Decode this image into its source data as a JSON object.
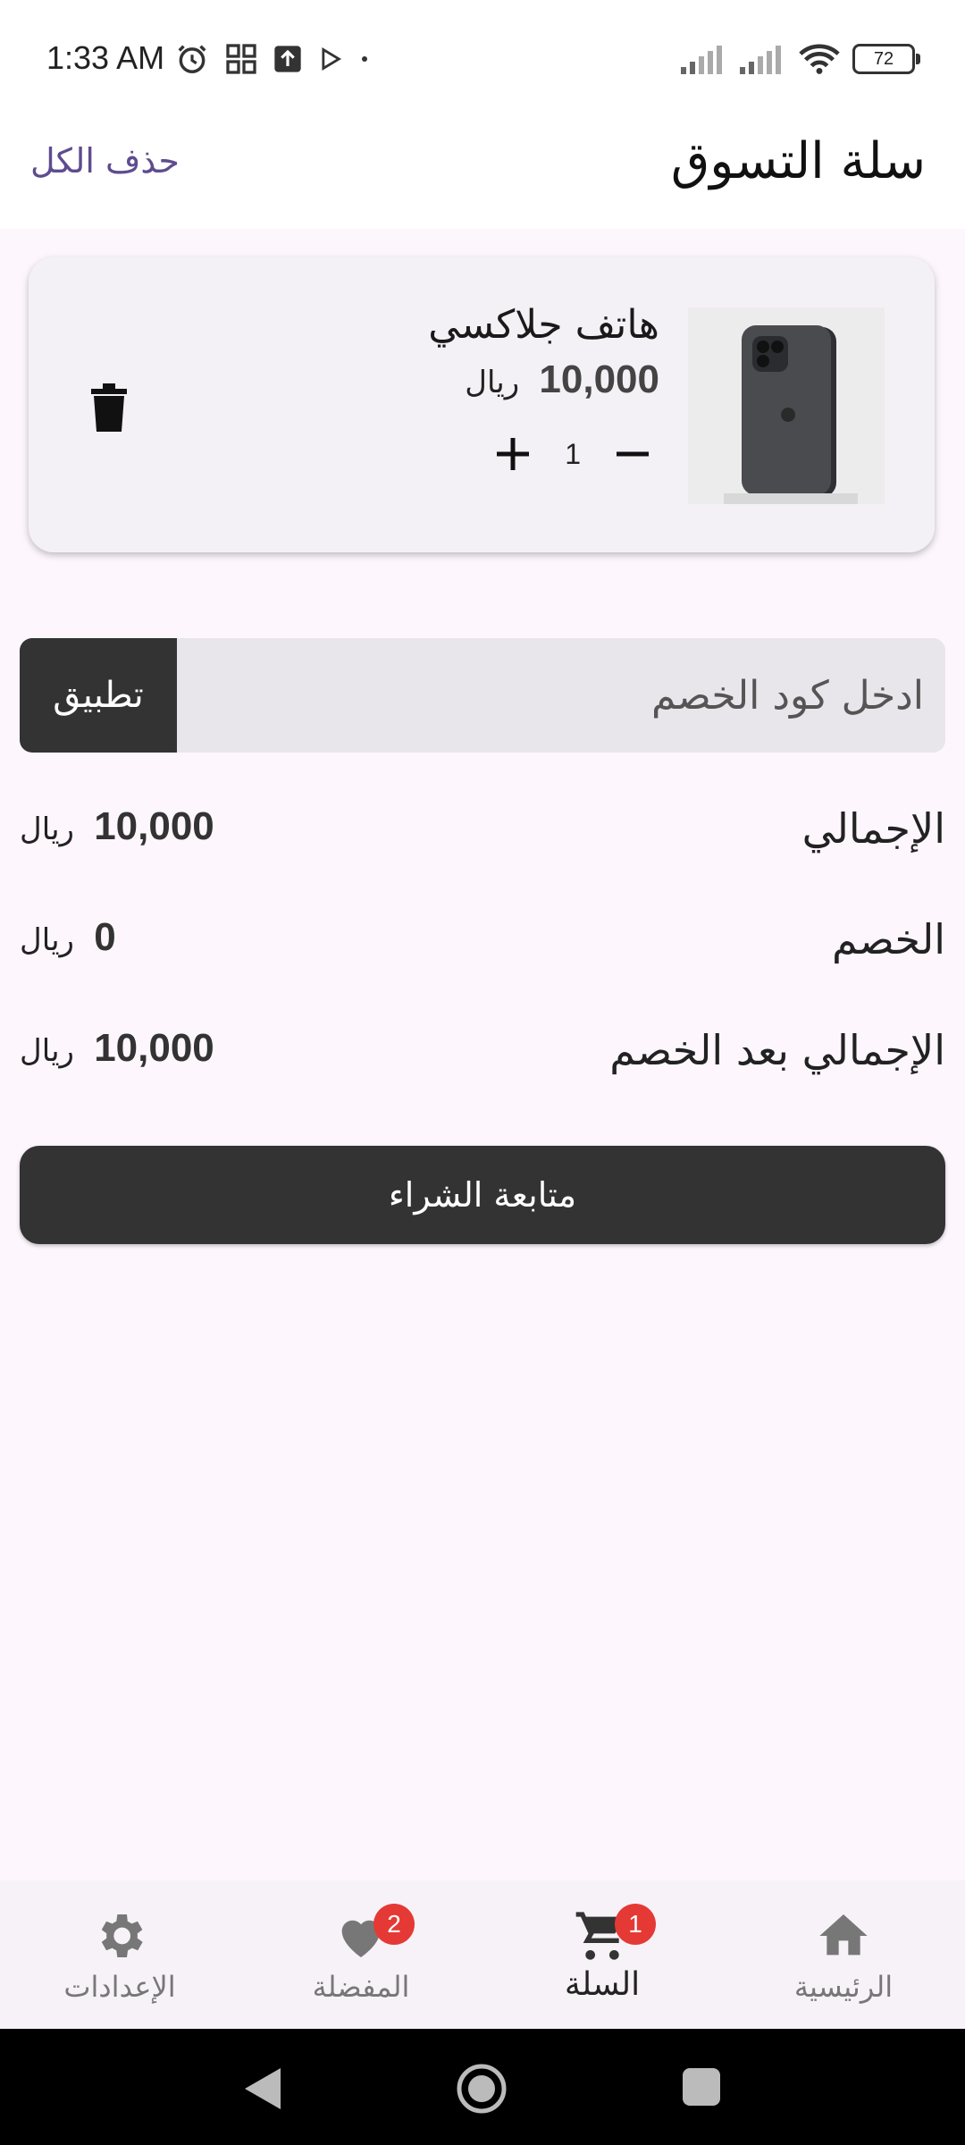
{
  "status_bar": {
    "time": "1:33 AM",
    "battery": "72",
    "left_icons": [
      "alarm-icon",
      "grid-app-icon",
      "upload-icon",
      "play-store-icon",
      "dot-icon"
    ],
    "right_icons": [
      "signal-icon",
      "signal-icon",
      "wifi-icon",
      "battery-icon"
    ]
  },
  "app_bar": {
    "title": "سلة التسوق",
    "clear_all_label": "حذف الكل"
  },
  "cart": {
    "items": [
      {
        "name": "هاتف جلاكسي",
        "price": "10,000",
        "currency": "ريال",
        "quantity": "1",
        "image_icon": "phone-image"
      }
    ]
  },
  "coupon": {
    "placeholder": "ادخل كود الخصم",
    "apply_label": "تطبيق"
  },
  "summary": {
    "total_label": "الإجمالي",
    "total_value": "10,000",
    "discount_label": "الخصم",
    "discount_value": "0",
    "net_label": "الإجمالي بعد الخصم",
    "net_value": "10,000",
    "currency": "ريال"
  },
  "checkout": {
    "label": "متابعة الشراء"
  },
  "bottom_nav": {
    "items": [
      {
        "label": "الإعدادات",
        "icon": "gear-icon",
        "badge": ""
      },
      {
        "label": "المفضلة",
        "icon": "heart-icon",
        "badge": "2"
      },
      {
        "label": "السلة",
        "icon": "cart-icon",
        "badge": "1"
      },
      {
        "label": "الرئيسية",
        "icon": "home-icon",
        "badge": ""
      }
    ],
    "active": "السلة"
  },
  "colors": {
    "accent_link": "#5e4c8f",
    "dark_button": "#333333",
    "badge": "#e53935",
    "background": "#fdf7fd"
  }
}
